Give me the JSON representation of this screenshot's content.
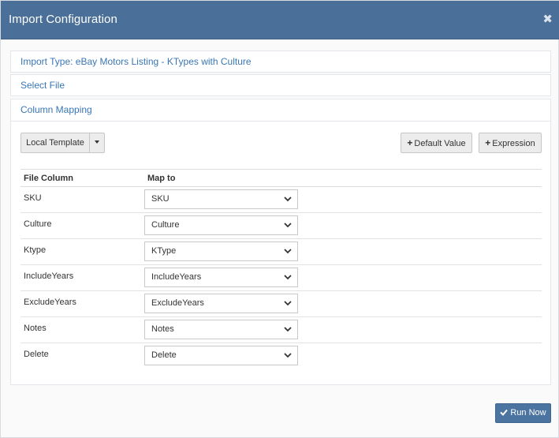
{
  "modal": {
    "title": "Import Configuration",
    "close_glyph": "✖"
  },
  "panels": {
    "import_type": "Import Type: eBay Motors Listing - KTypes with Culture",
    "select_file": "Select File",
    "column_mapping": "Column Mapping"
  },
  "toolbar": {
    "template_label": "Local Template",
    "default_value_label": "Default Value",
    "expression_label": "Expression",
    "plus_glyph": "+"
  },
  "table": {
    "headers": [
      "File Column",
      "Map to"
    ],
    "rows": [
      {
        "file_column": "SKU",
        "map_to": "SKU"
      },
      {
        "file_column": "Culture",
        "map_to": "Culture"
      },
      {
        "file_column": "Ktype",
        "map_to": "KType"
      },
      {
        "file_column": "IncludeYears",
        "map_to": "IncludeYears"
      },
      {
        "file_column": "ExcludeYears",
        "map_to": "ExcludeYears"
      },
      {
        "file_column": "Notes",
        "map_to": "Notes"
      },
      {
        "file_column": "Delete",
        "map_to": "Delete"
      }
    ]
  },
  "footer": {
    "run_label": "Run Now"
  },
  "colors": {
    "header_bg": "#4a6f98",
    "link": "#3a76b4",
    "primary_button": "#4c74a0"
  },
  "icons": {
    "close": "close-icon",
    "caret": "caret-down-icon",
    "plus": "plus-icon",
    "chevron": "chevron-down-icon",
    "check": "check-icon"
  }
}
